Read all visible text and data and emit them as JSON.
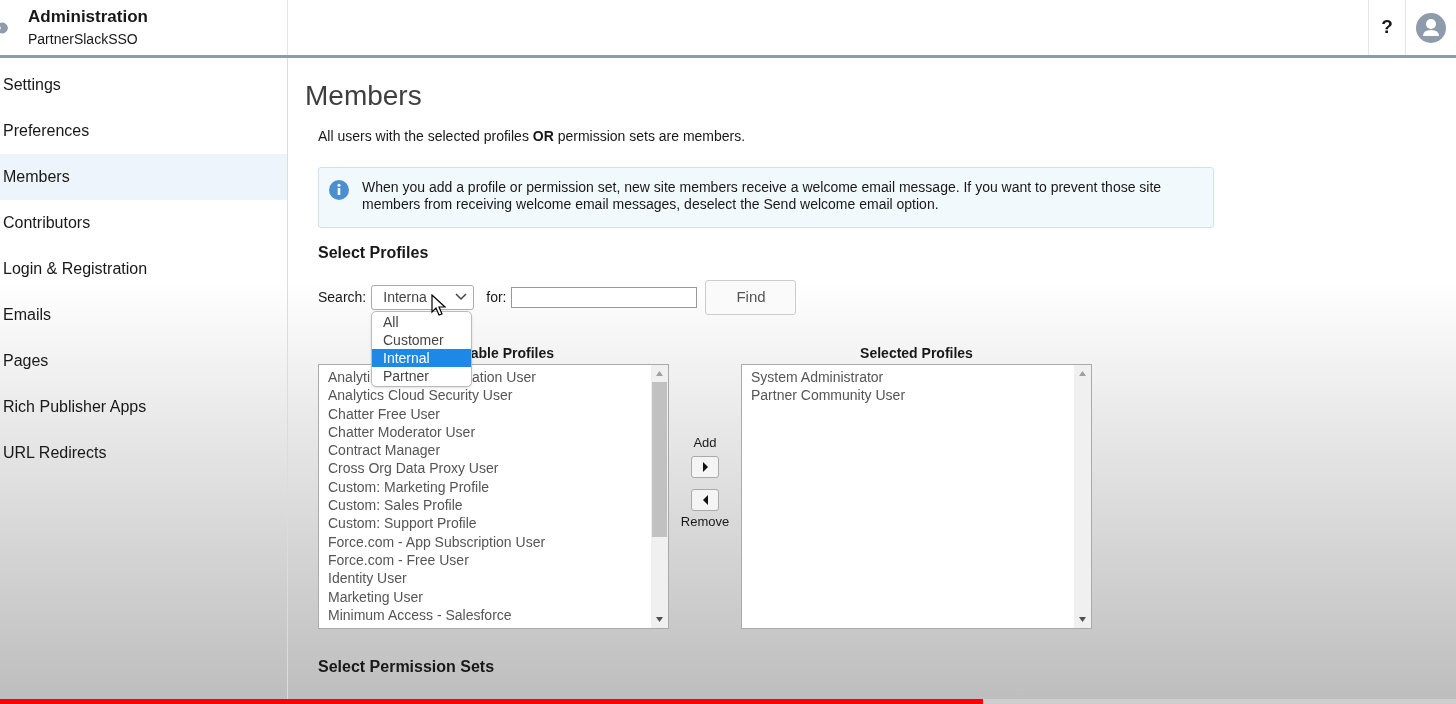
{
  "header": {
    "title": "Administration",
    "subtitle": "PartnerSlackSSO",
    "help": "?"
  },
  "sidebar": {
    "items": [
      {
        "label": "Settings",
        "selected": false
      },
      {
        "label": "Preferences",
        "selected": false
      },
      {
        "label": "Members",
        "selected": true
      },
      {
        "label": "Contributors",
        "selected": false
      },
      {
        "label": "Login & Registration",
        "selected": false
      },
      {
        "label": "Emails",
        "selected": false
      },
      {
        "label": "Pages",
        "selected": false
      },
      {
        "label": "Rich Publisher Apps",
        "selected": false
      },
      {
        "label": "URL Redirects",
        "selected": false
      }
    ]
  },
  "page": {
    "title": "Members",
    "intro": "All users with the selected profiles **OR** permission sets are members.",
    "info": "When you add a profile or permission set, new site members receive a welcome email message. If you want to prevent those site members from receiving welcome email messages, deselect the Send welcome email option.",
    "select_profiles": {
      "heading": "Select Profiles",
      "search_label": "Search:",
      "search_value": "Interna",
      "for_label": "for:",
      "find": "Find",
      "dropdown": [
        {
          "label": "All",
          "selected": false
        },
        {
          "label": "Customer",
          "selected": false
        },
        {
          "label": "Internal",
          "selected": true
        },
        {
          "label": "Partner",
          "selected": false
        }
      ],
      "available_heading": "able Profiles",
      "available": [
        {
          "parts": [
            "Analyti",
            "ation User"
          ]
        },
        {
          "parts": [
            "Analytics Cloud Security User"
          ]
        },
        {
          "parts": [
            "Chatter Free User"
          ]
        },
        {
          "parts": [
            "Chatter Moderator User"
          ]
        },
        {
          "parts": [
            "Contract Manager"
          ]
        },
        {
          "parts": [
            "Cross Org Data Proxy User"
          ]
        },
        {
          "parts": [
            "Custom: Marketing Profile"
          ]
        },
        {
          "parts": [
            "Custom: Sales Profile"
          ]
        },
        {
          "parts": [
            "Custom: Support Profile"
          ]
        },
        {
          "parts": [
            "Force.com - App Subscription User"
          ]
        },
        {
          "parts": [
            "Force.com - Free User"
          ]
        },
        {
          "parts": [
            "Identity User"
          ]
        },
        {
          "parts": [
            "Marketing User"
          ]
        },
        {
          "parts": [
            "Minimum Access - Salesforce"
          ]
        }
      ],
      "add": "Add",
      "remove": "Remove",
      "selected_heading": "Selected Profiles",
      "selected": [
        "System Administrator",
        "Partner Community User"
      ]
    },
    "permission_sets_heading": "Select Permission Sets"
  },
  "video_progress": {
    "level": 0.675
  }
}
